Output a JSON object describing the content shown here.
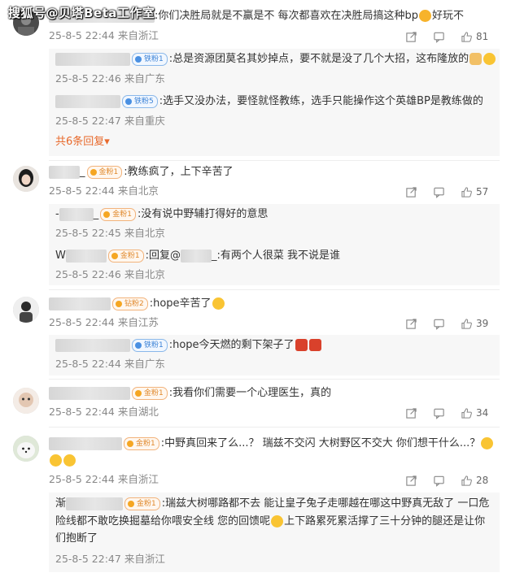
{
  "watermark": "搜狐号@贝塔Beta工作室",
  "comments": [
    {
      "text": ":你们决胜局就是不赢是不 每次都喜欢在决胜局搞这种bp",
      "text_tail": "好玩不",
      "time": "25-8-5 22:44",
      "location": "来自浙江",
      "likes": "81",
      "replies": [
        {
          "badge": "铁粉1",
          "text": ":总是资源团莫名其妙掉点，要不就是没了几个大招，这布隆放的",
          "time": "25-8-5 22:46",
          "location": "来自广东"
        },
        {
          "badge": "铁粉5",
          "text": ":选手又没办法，要怪就怪教练，选手只能操作这个英雄BP是教练做的",
          "time": "25-8-5 22:47",
          "location": "来自重庆"
        }
      ],
      "more_replies": "共6条回复"
    },
    {
      "name_suffix": "_",
      "badge": "金粉1",
      "text": ":教练疯了，上下辛苦了",
      "time": "25-8-5 22:44",
      "location": "来自北京",
      "likes": "57",
      "replies": [
        {
          "name_prefix": "-",
          "name_suffix": "_",
          "badge": "金粉1",
          "text": ":没有说中野辅打得好的意思",
          "time": "25-8-5 22:45",
          "location": "来自北京"
        },
        {
          "name_prefix": "W",
          "badge": "金粉1",
          "text_prefix": ":回复@",
          "text_suffix": "_:有两个人很菜 我不说是谁",
          "time": "25-8-5 22:46",
          "location": "来自北京"
        }
      ]
    },
    {
      "badge": "钻粉2",
      "text": ":hope辛苦了",
      "time": "25-8-5 22:44",
      "location": "来自江苏",
      "likes": "39",
      "replies": [
        {
          "badge": "铁粉1",
          "text": ":hope今天燃的剩下架子了",
          "time": "25-8-5 22:44",
          "location": "来自广东"
        }
      ]
    },
    {
      "badge": "金粉1",
      "text": ":我看你们需要一个心理医生，真的",
      "time": "25-8-5 22:44",
      "location": "来自湖北",
      "likes": "34",
      "replies": []
    },
    {
      "badge": "金粉1",
      "text": ":中野真回来了么...？ 瑞兹不交闪 大树野区不交大 你们想干什么...？",
      "time": "25-8-5 22:44",
      "location": "来自浙江",
      "likes": "28",
      "replies": [
        {
          "name_prefix": "渐",
          "badge": "金粉1",
          "text": ":瑞兹大树哪路都不去 能让皇子兔子走哪越在哪这中野真无敌了 一口危",
          "text2": "险线都不敢吃换掘墓给你喂安全线 您的回馈呢",
          "text2_tail": "上下路累死累活撑了三十分钟的腿还是让你",
          "text3": "们抱断了",
          "time": "25-8-5 22:47",
          "location": "来自浙江"
        }
      ]
    }
  ],
  "icons": {
    "share": "share-icon",
    "comment": "comment-icon",
    "like": "like-icon"
  },
  "colors": {
    "accent": "#e8692b",
    "meta": "#888888",
    "reply_bg": "#f7f7f7"
  }
}
